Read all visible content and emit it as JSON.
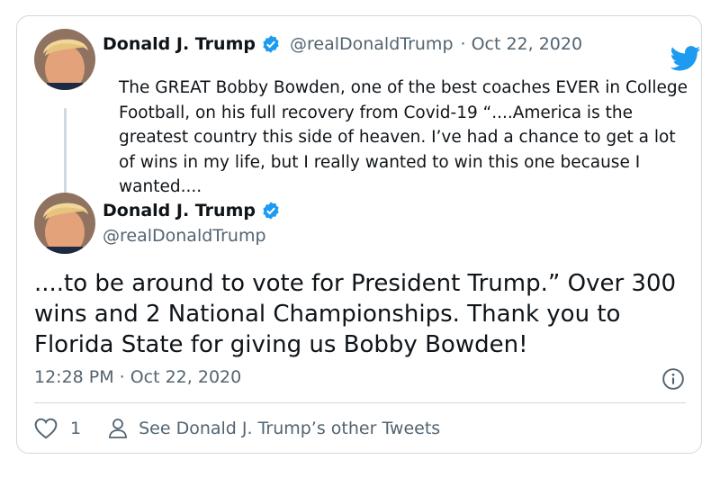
{
  "quoted_tweet": {
    "author_name": "Donald J. Trump",
    "handle": "@realDonaldTrump",
    "separator": "·",
    "date": "Oct 22, 2020",
    "text": "The GREAT Bobby Bowden, one of the best coaches EVER in College Football, on his full recovery from Covid-19 “....America is the greatest country this side of heaven. I’ve had a chance to get a lot of wins in my life, but I really wanted to win this one because I wanted...."
  },
  "main_tweet": {
    "author_name": "Donald J. Trump",
    "handle": "@realDonaldTrump",
    "text": "....to be around to vote for President Trump.” Over 300 wins and 2 National Championships. Thank you to Florida State for giving us Bobby Bowden!",
    "time": "12:28 PM",
    "separator": "·",
    "date": "Oct 22, 2020"
  },
  "actions": {
    "like_count": "1",
    "other_tweets_label": "See Donald J. Trump’s other Tweets"
  },
  "colors": {
    "text": "#0f1419",
    "secondary": "#536471",
    "verified": "#1d9bf0",
    "twitter_blue": "#1d9bf0",
    "border": "#cfd9de"
  },
  "icons": {
    "logo": "twitter-bird-icon",
    "verified": "verified-badge-icon",
    "info": "info-icon",
    "like": "heart-icon",
    "profile": "person-icon"
  }
}
